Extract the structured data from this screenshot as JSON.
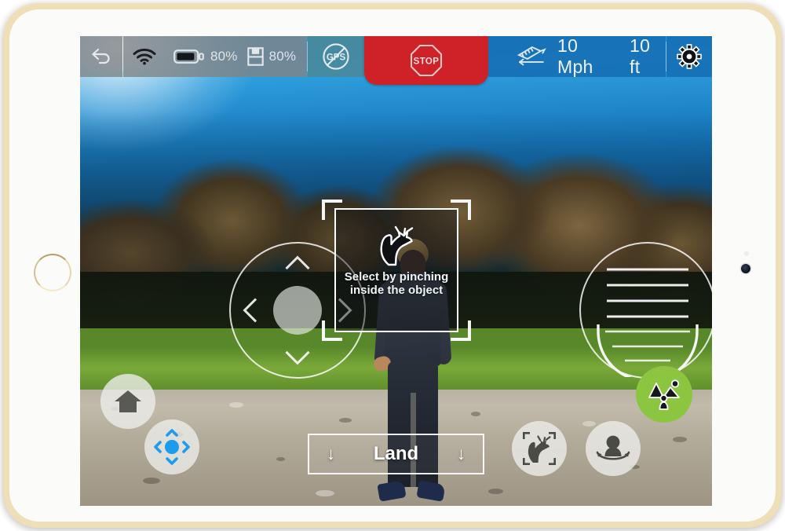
{
  "device": {
    "name": "tablet-gold",
    "frame_color": "#e8d3a4",
    "bezel_color": "#fbfbfa"
  },
  "app": {
    "name": "drone-flight-controller",
    "accent_green": "#8cc540",
    "accent_red": "#cf2128",
    "accent_blue": "#166eb4",
    "accent_teal": "#4a8694"
  },
  "top_bar": {
    "back_icon": "back-arrow-icon",
    "wifi_icon": "wifi-icon",
    "battery": {
      "icon": "battery-icon",
      "value": "80%",
      "level_percent": 80
    },
    "storage": {
      "icon": "sd-card-icon",
      "value": "80%",
      "level_percent": 80
    },
    "gps": {
      "icon": "gps-disabled-icon",
      "label": "GPS",
      "enabled": false
    },
    "emergency_stop": {
      "icon": "stop-sign-icon",
      "label": "STOP"
    },
    "telemetry": {
      "icon": "speed-distance-icon",
      "speed": "10 Mph",
      "altitude": "10 ft"
    },
    "settings_icon": "gear-icon"
  },
  "controls": {
    "left_joystick": {
      "name": "directional-joystick",
      "chevrons": [
        "up",
        "down",
        "left",
        "right"
      ]
    },
    "right_joystick": {
      "name": "altitude-throttle-slider",
      "ladder_rungs": 4,
      "u_indicator_rungs": 3
    }
  },
  "overlay": {
    "instruction": "Select by pinching inside the object",
    "gesture_icon": "pinch-hand-icon",
    "reticle_corners": 4
  },
  "bottom_controls": {
    "home_button": {
      "icon": "home-icon",
      "label": "Return Home"
    },
    "recenter_button": {
      "icon": "dpad-recenter-icon",
      "accent": "#1d9bef"
    },
    "land_button": {
      "label": "Land",
      "left_arrow": "↓",
      "right_arrow": "↓"
    },
    "select_mode_button": {
      "icon": "pinch-select-icon"
    },
    "orbit_mode_button": {
      "icon": "follow-person-icon"
    },
    "scene_mode_button": {
      "icon": "landscape-scene-icon",
      "active": true,
      "color": "#8cc540"
    }
  }
}
